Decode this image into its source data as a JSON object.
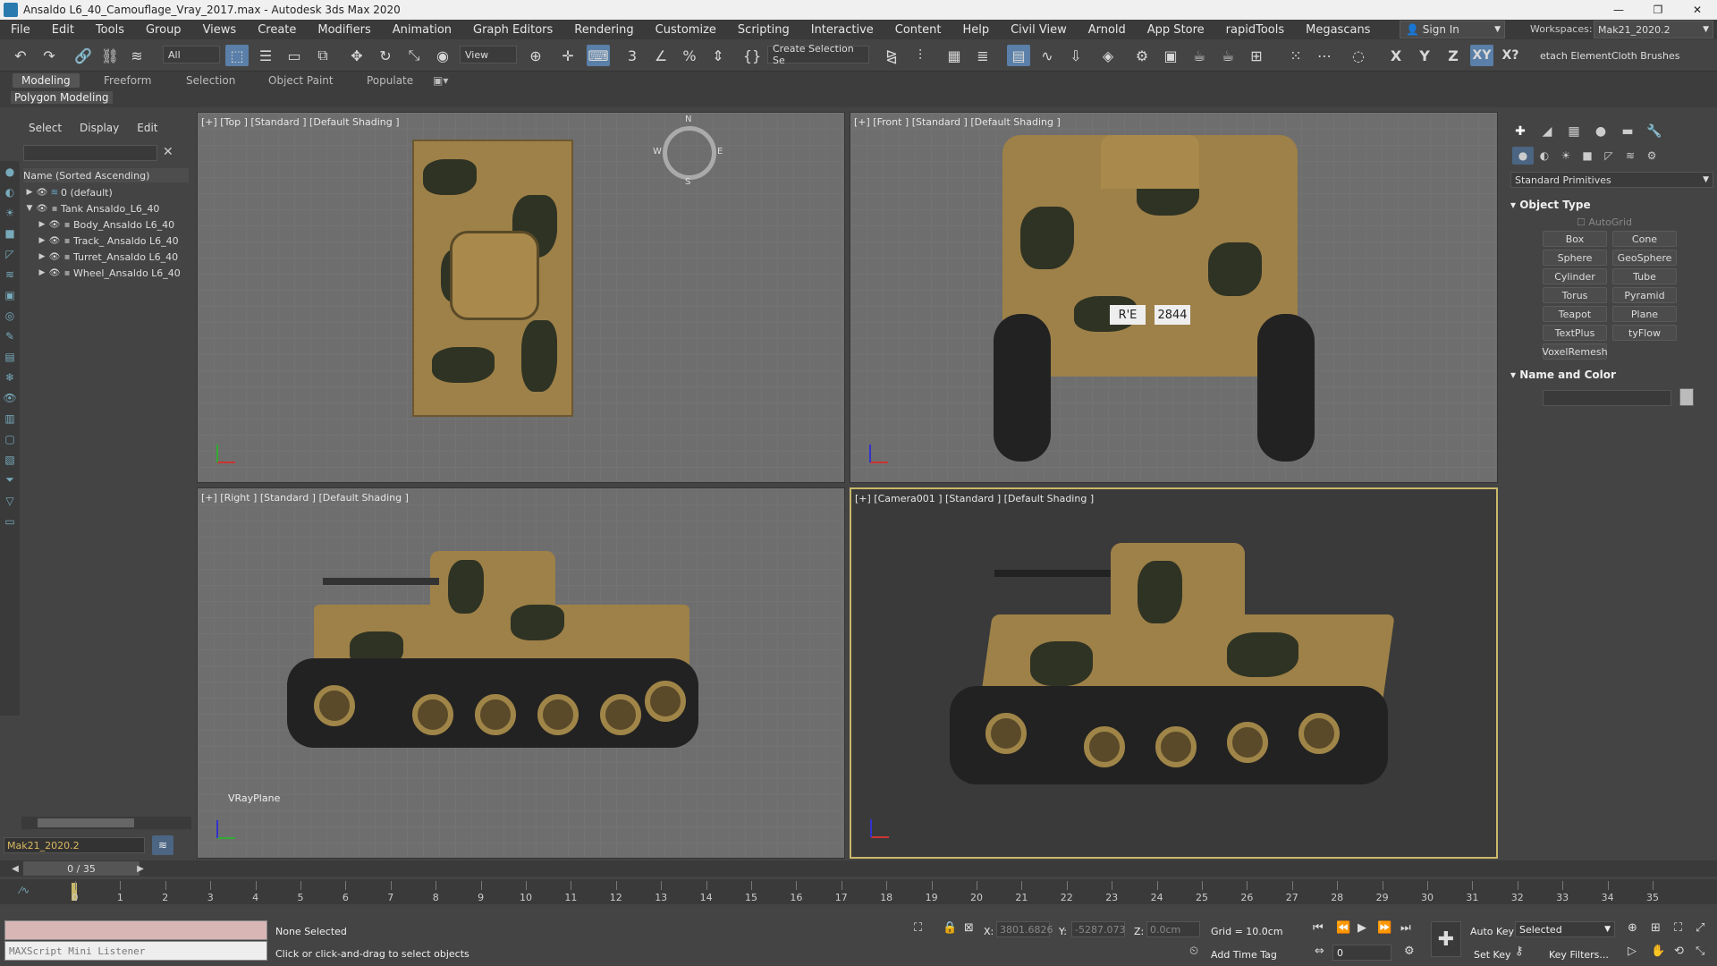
{
  "window": {
    "title": "Ansaldo L6_40_Camouflage_Vray_2017.max - Autodesk 3ds Max 2020",
    "min": "—",
    "max": "❐",
    "close": "✕"
  },
  "menu": [
    "File",
    "Edit",
    "Tools",
    "Group",
    "Views",
    "Create",
    "Modifiers",
    "Animation",
    "Graph Editors",
    "Rendering",
    "Customize",
    "Scripting",
    "Interactive",
    "Content",
    "Help",
    "Civil View",
    "Arnold",
    "App Store",
    "rapidTools",
    "Megascans"
  ],
  "signin": "Sign In",
  "workspace": {
    "label": "Workspaces:",
    "value": "Mak21_2020.2"
  },
  "toolbar": {
    "filter": "All",
    "refcoord": "View",
    "selset": "Create Selection Se",
    "axes": [
      "X",
      "Y",
      "Z",
      "XY",
      "X?"
    ],
    "detach": "etach Element",
    "cloth": "Cloth Brushes"
  },
  "ribbon": {
    "tabs": [
      "Modeling",
      "Freeform",
      "Selection",
      "Object Paint",
      "Populate"
    ],
    "panel": "Polygon Modeling"
  },
  "scene_explorer": {
    "tabs": [
      "Select",
      "Display",
      "Edit"
    ],
    "column": "Name (Sorted Ascending)",
    "items": [
      {
        "label": "0 (default)"
      },
      {
        "label": "Tank Ansaldo_L6_40"
      },
      {
        "label": "Body_Ansaldo L6_40"
      },
      {
        "label": "Track_ Ansaldo L6_40"
      },
      {
        "label": "Turret_Ansaldo L6_40"
      },
      {
        "label": "Wheel_Ansaldo L6_40"
      }
    ],
    "layer": "Mak21_2020.2"
  },
  "viewports": {
    "top": "[+] [Top ] [Standard ] [Default Shading ]",
    "front": "[+] [Front ] [Standard ] [Default Shading ]",
    "right": "[+] [Right ] [Standard ] [Default Shading ]",
    "camera": "[+] [Camera001 ] [Standard ] [Default Shading ]",
    "vrayplane": "VRayPlane",
    "compass": {
      "n": "N",
      "s": "S",
      "w": "W",
      "e": "E"
    },
    "plate": {
      "left": "R'E",
      "right": "2844"
    }
  },
  "command_panel": {
    "category": "Standard Primitives",
    "object_type": "Object Type",
    "autogrid": "AutoGrid",
    "buttons": [
      "Box",
      "Cone",
      "Sphere",
      "GeoSphere",
      "Cylinder",
      "Tube",
      "Torus",
      "Pyramid",
      "Teapot",
      "Plane",
      "TextPlus",
      "tyFlow",
      "VoxelRemesh"
    ],
    "name_color": "Name and Color"
  },
  "timeline": {
    "slider": "0 / 35",
    "ticks": [
      "0",
      "1",
      "2",
      "3",
      "4",
      "5",
      "6",
      "7",
      "8",
      "9",
      "10",
      "11",
      "12",
      "13",
      "14",
      "15",
      "16",
      "17",
      "18",
      "19",
      "20",
      "21",
      "22",
      "23",
      "24",
      "25",
      "26",
      "27",
      "28",
      "29",
      "30",
      "31",
      "32",
      "33",
      "34",
      "35"
    ]
  },
  "status": {
    "listener": "MAXScript Mini Listener",
    "selection": "None Selected",
    "prompt": "Click or click-and-drag to select objects",
    "x_label": "X:",
    "x": "3801.6826",
    "y_label": "Y:",
    "y": "-5287.073",
    "z_label": "Z:",
    "z": "0.0cm",
    "grid": "Grid = 10.0cm",
    "add_time_tag": "Add Time Tag",
    "auto_key": "Auto Key",
    "set_key": "Set Key",
    "selected": "Selected",
    "frame": "0",
    "key_filters": "Key Filters..."
  },
  "colors": {
    "accent": "#4b6582",
    "active_viewport": "#c9b86a",
    "camo_tan": "#9e8148",
    "camo_dark": "#2f3324"
  }
}
